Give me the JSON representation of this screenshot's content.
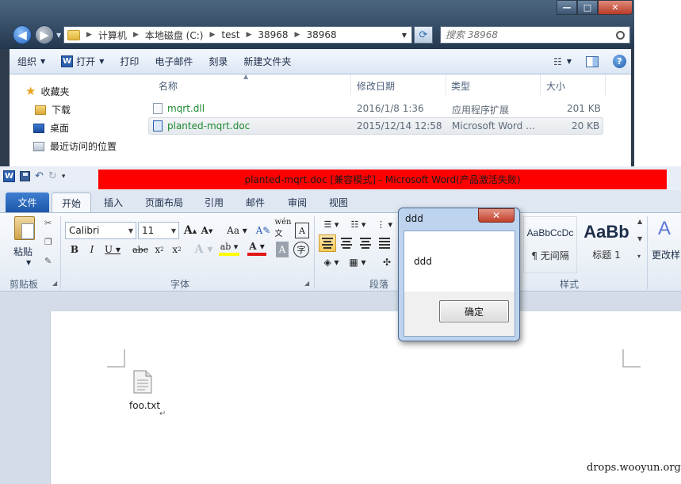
{
  "explorer": {
    "window_controls": {
      "min": "—",
      "max": "□",
      "close": "✕"
    },
    "address": {
      "crumbs": [
        "计算机",
        "本地磁盘 (C:)",
        "test",
        "38968",
        "38968"
      ]
    },
    "search": {
      "placeholder": "搜索 38968"
    },
    "commands": {
      "organize": "组织",
      "open": "打开",
      "print": "打印",
      "email": "电子邮件",
      "burn": "刻录",
      "new_folder": "新建文件夹"
    },
    "nav": {
      "favorites": "收藏夹",
      "downloads": "下载",
      "desktop": "桌面",
      "recent": "最近访问的位置"
    },
    "columns": {
      "name": "名称",
      "modified": "修改日期",
      "type": "类型",
      "size": "大小"
    },
    "files": [
      {
        "name": "mqrt.dll",
        "modified": "2016/1/8 1:36",
        "type": "应用程序扩展",
        "size": "201 KB"
      },
      {
        "name": "planted-mqrt.doc",
        "modified": "2015/12/14 12:58",
        "type": "Microsoft Word ...",
        "size": "20 KB"
      }
    ]
  },
  "word": {
    "title": "planted-mqrt.doc [兼容模式] - Microsoft Word(产品激活失败)",
    "tabs": {
      "file": "文件",
      "home": "开始",
      "insert": "插入",
      "layout": "页面布局",
      "references": "引用",
      "mailings": "邮件",
      "review": "审阅",
      "view": "视图"
    },
    "ribbon": {
      "paste": "粘贴",
      "clipboard": "剪贴板",
      "font_group": "字体",
      "paragraph_group": "段落",
      "styles_group": "样式",
      "font_name": "Calibri",
      "font_size": "11",
      "style_normal_sample": "AaBbCcDc",
      "style_normal": "¶ 无间隔",
      "style_h1_sample": "AaBb",
      "style_h1": "标题 1",
      "change_styles": "更改样"
    },
    "document": {
      "attachment_label": "foo.txt"
    }
  },
  "msgbox": {
    "title": "ddd",
    "text": "ddd",
    "ok": "确定",
    "close": "✕"
  },
  "watermark": "drops.wooyun.org"
}
